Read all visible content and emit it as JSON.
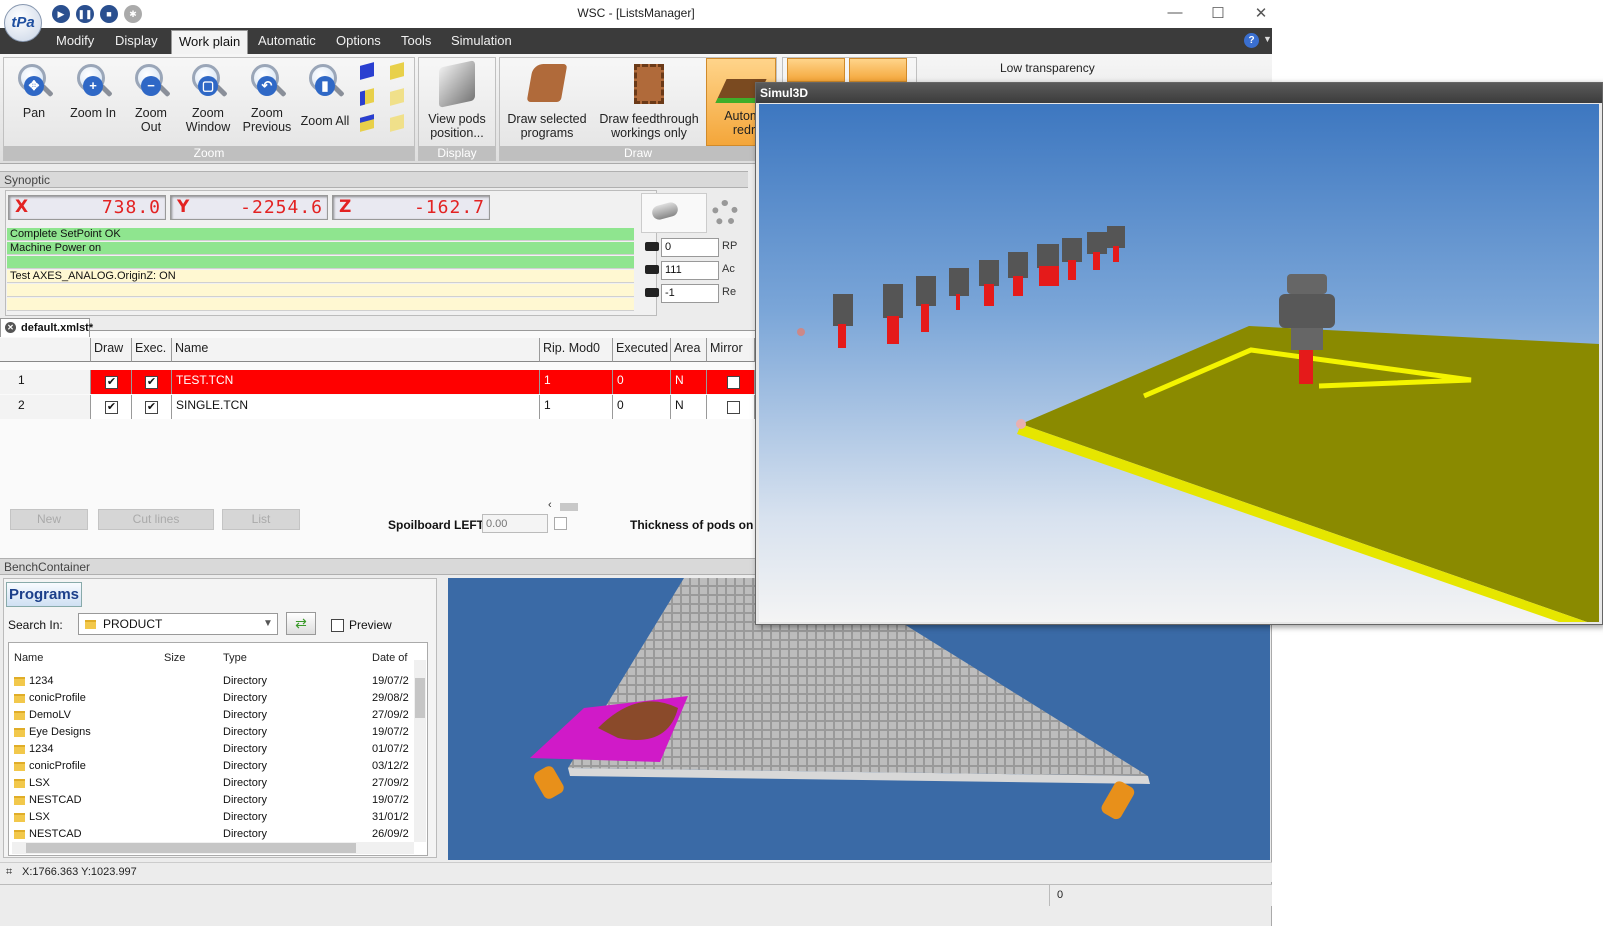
{
  "window": {
    "title": "WSC - [ListsManager]",
    "logo_text": "tPa"
  },
  "quick_access": [
    "play-icon",
    "pause-icon",
    "stop-icon",
    "gear-icon"
  ],
  "menu": [
    {
      "label": "Modify",
      "active": false
    },
    {
      "label": "Display",
      "active": false
    },
    {
      "label": "Work plain",
      "active": true
    },
    {
      "label": "Automatic",
      "active": false
    },
    {
      "label": "Options",
      "active": false
    },
    {
      "label": "Tools",
      "active": false
    },
    {
      "label": "Simulation",
      "active": false
    }
  ],
  "ribbon": {
    "zoom_group": {
      "label": "Zoom",
      "buttons": [
        {
          "label": "Pan",
          "icon": "pan-icon",
          "sym": "✥"
        },
        {
          "label": "Zoom In",
          "icon": "zoom-in-icon",
          "sym": "+"
        },
        {
          "label": "Zoom Out",
          "icon": "zoom-out-icon",
          "sym": "−"
        },
        {
          "label": "Zoom Window",
          "icon": "zoom-window-icon",
          "sym": "▢"
        },
        {
          "label": "Zoom Previous",
          "icon": "zoom-previous-icon",
          "sym": "↶"
        },
        {
          "label": "Zoom All",
          "icon": "zoom-all-icon",
          "sym": "▮"
        }
      ]
    },
    "display_group": {
      "label": "Display",
      "button": "View pods position..."
    },
    "draw_group": {
      "label": "Draw",
      "buttons": [
        "Draw selected programs",
        "Draw feedthrough workings only",
        "Automatic redraw"
      ]
    },
    "transparency_label": "Low transparency"
  },
  "synoptic": {
    "header": "Synoptic",
    "axes": [
      {
        "label": "X",
        "value": "738.0"
      },
      {
        "label": "Y",
        "value": "-2254.6"
      },
      {
        "label": "Z",
        "value": "-162.7"
      }
    ],
    "messages": [
      {
        "text": "Complete SetPoint OK",
        "color": "#8fe58f"
      },
      {
        "text": "Machine Power on",
        "color": "#8fe58f"
      },
      {
        "text": "",
        "color": "#8fe58f"
      },
      {
        "text": "Test AXES_ANALOG.OriginZ: ON",
        "color": "#fff8d2"
      },
      {
        "text": "",
        "color": "#fff8d2"
      },
      {
        "text": "",
        "color": "#fff8d2"
      }
    ],
    "side_values": [
      {
        "value": "0",
        "label": "RP"
      },
      {
        "value": "111",
        "label": "Ac"
      },
      {
        "value": "-1",
        "label": "Re"
      }
    ]
  },
  "list": {
    "tab": "default.xmlst*",
    "columns": [
      "Draw",
      "Exec.",
      "Name",
      "Rip. Mod0",
      "Executed",
      "Area",
      "Mirror"
    ],
    "rows": [
      {
        "num": "1",
        "draw": true,
        "exec": true,
        "name": "TEST.TCN",
        "rip": "1",
        "executed": "0",
        "area": "N",
        "mirror": false,
        "selected": true
      },
      {
        "num": "2",
        "draw": true,
        "exec": true,
        "name": "SINGLE.TCN",
        "rip": "1",
        "executed": "0",
        "area": "N",
        "mirror": false,
        "selected": false
      }
    ],
    "buttons": [
      "New",
      "Cut lines",
      "List"
    ],
    "spoilboard_label": "Spoilboard LEFT",
    "spoilboard_placeholder": "0.00",
    "thickness_label": "Thickness of pods on RT"
  },
  "bench": {
    "header": "BenchContainer",
    "programs_tab": "Programs",
    "search_label": "Search In:",
    "search_value": "PRODUCT",
    "preview_label": "Preview",
    "file_columns": [
      "Name",
      "Size",
      "Type",
      "Date of"
    ],
    "files": [
      {
        "name": "1234",
        "type": "Directory",
        "date": "19/07/2"
      },
      {
        "name": "conicProfile",
        "type": "Directory",
        "date": "29/08/2"
      },
      {
        "name": "DemoLV",
        "type": "Directory",
        "date": "27/09/2"
      },
      {
        "name": "Eye Designs",
        "type": "Directory",
        "date": "19/07/2"
      },
      {
        "name": "1234",
        "type": "Directory",
        "date": "01/07/2"
      },
      {
        "name": "conicProfile",
        "type": "Directory",
        "date": "03/12/2"
      },
      {
        "name": "LSX",
        "type": "Directory",
        "date": "27/09/2"
      },
      {
        "name": "NESTCAD",
        "type": "Directory",
        "date": "19/07/2"
      },
      {
        "name": "LSX",
        "type": "Directory",
        "date": "31/01/2"
      },
      {
        "name": "NESTCAD",
        "type": "Directory",
        "date": "26/09/2"
      }
    ]
  },
  "status_bar": {
    "coords": "X:1766.363 Y:1023.997",
    "counter": "0"
  },
  "simul3d": {
    "title": "Simul3D"
  },
  "colors": {
    "menubar": "#3b3b3b",
    "selected_row": "#ff0000",
    "axis_text": "#e32222",
    "panel_yellow": "#8a8a00",
    "viewport_blue": "#3a6aa6"
  }
}
